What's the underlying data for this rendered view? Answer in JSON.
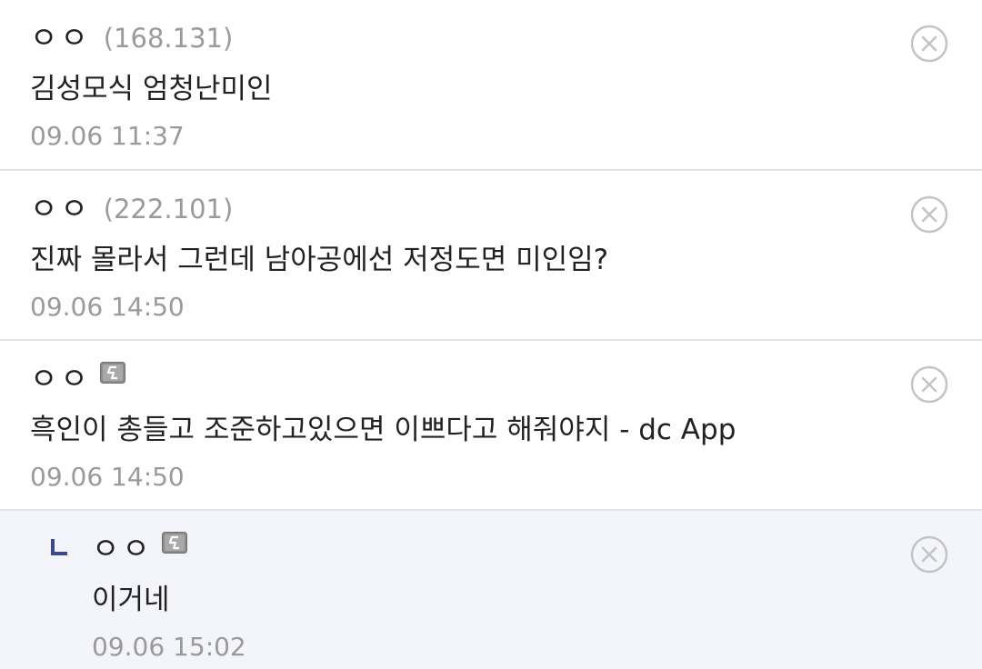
{
  "comments": [
    {
      "author": "ㅇㅇ",
      "ip": "(168.131)",
      "text": "김성모식 엄청난미인",
      "date": "09.06 11:37"
    },
    {
      "author": "ㅇㅇ",
      "ip": "(222.101)",
      "text": "진짜 몰라서 그런데 남아공에선 저정도면 미인임?",
      "date": "09.06 14:50"
    },
    {
      "author": "ㅇㅇ",
      "text": "흑인이 총들고 조준하고있으면 이쁘다고 해줘야지 - dc App",
      "date": "09.06 14:50"
    },
    {
      "author": "ㅇㅇ",
      "text": "이거네",
      "date": "09.06 15:02"
    }
  ],
  "icons": {
    "delete": "close-circle-icon",
    "mobile": "mobile-app-icon",
    "reply": "reply-corner-icon"
  },
  "colors": {
    "reply_background": "#f4f5fa",
    "reply_marker": "#3b4890",
    "meta_text": "#9a9a9a",
    "divider": "#e3e3e3"
  }
}
